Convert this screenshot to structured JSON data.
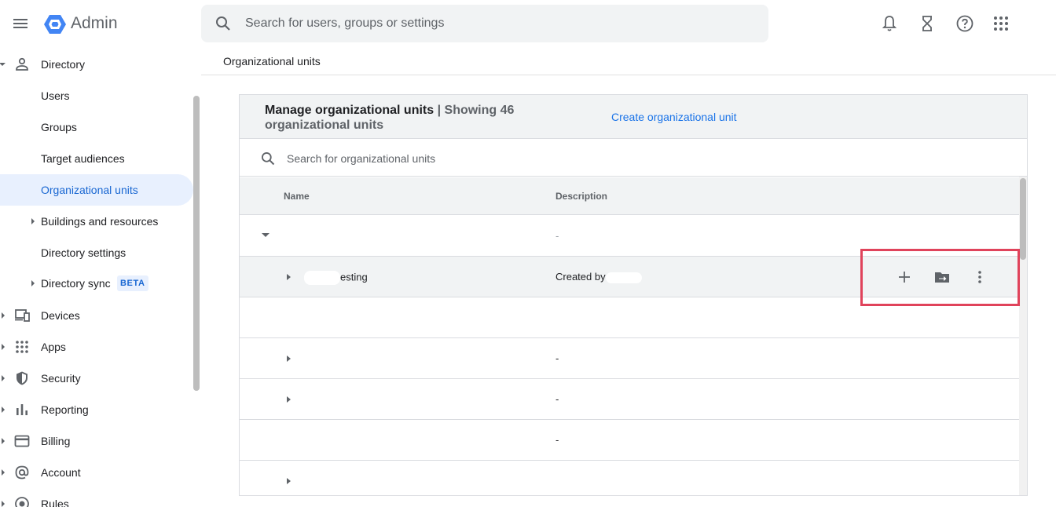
{
  "header": {
    "app_title": "Admin",
    "search_placeholder": "Search for users, groups or settings",
    "icons": [
      "notifications-icon",
      "hourglass-icon",
      "help-icon",
      "apps-grid-icon"
    ]
  },
  "sidebar": {
    "items": [
      {
        "label": "Directory",
        "icon": "person-icon",
        "expanded": true
      },
      {
        "label": "Users"
      },
      {
        "label": "Groups"
      },
      {
        "label": "Target audiences"
      },
      {
        "label": "Organizational units",
        "active": true
      },
      {
        "label": "Buildings and resources",
        "collapsed": true
      },
      {
        "label": "Directory settings"
      },
      {
        "label": "Directory sync",
        "badge": "BETA",
        "collapsed": true
      },
      {
        "label": "Devices",
        "icon": "devices-icon"
      },
      {
        "label": "Apps",
        "icon": "apps-icon"
      },
      {
        "label": "Security",
        "icon": "shield-icon"
      },
      {
        "label": "Reporting",
        "icon": "bar-chart-icon"
      },
      {
        "label": "Billing",
        "icon": "credit-card-icon"
      },
      {
        "label": "Account",
        "icon": "at-sign-icon"
      },
      {
        "label": "Rules",
        "icon": "rules-icon"
      }
    ]
  },
  "main": {
    "breadcrumb": "Organizational units",
    "card": {
      "title": "Manage organizational units",
      "separator": " | ",
      "count_text": "Showing 46 organizational units",
      "create_link": "Create organizational unit",
      "search_placeholder": "Search for organizational units",
      "columns": [
        "Name",
        "Description"
      ],
      "rows": [
        {
          "name": "",
          "description": "-",
          "caret": "down"
        },
        {
          "name": "esting",
          "description": "Created by",
          "caret": "right",
          "hover": true,
          "redacted": true
        },
        {
          "name": "",
          "description": "",
          "caret": "none"
        },
        {
          "name": "",
          "description": "-",
          "caret": "right"
        },
        {
          "name": "",
          "description": "-",
          "caret": "right"
        },
        {
          "name": "",
          "description": "-",
          "caret": "none"
        },
        {
          "name": "",
          "description": "",
          "caret": "right"
        }
      ],
      "row_actions": [
        "add-icon",
        "move-folder-icon",
        "more-vert-icon"
      ]
    }
  },
  "colors": {
    "accent": "#1a73e8",
    "active_bg": "#e8f0fe",
    "highlight_border": "#e0435b",
    "header_bg": "#f1f3f4"
  }
}
